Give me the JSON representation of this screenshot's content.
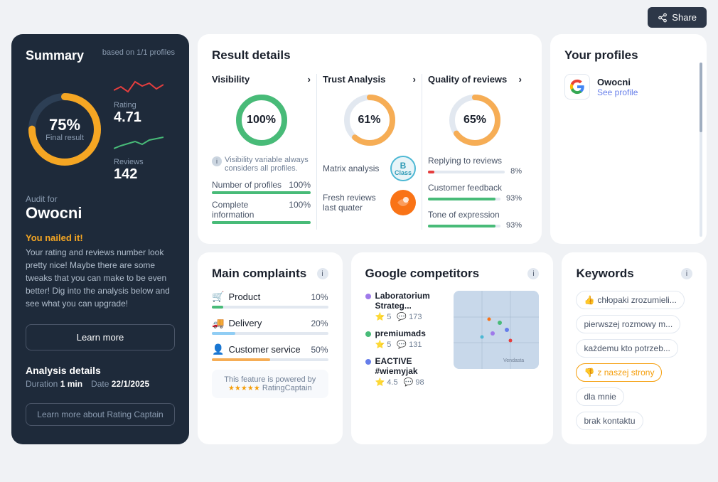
{
  "shareButton": {
    "label": "Share"
  },
  "summary": {
    "title": "Summary",
    "basedOn": "based on 1/1 profiles",
    "finalResultPercent": "75%",
    "finalResultLabel": "Final result",
    "ratingLabel": "Rating",
    "ratingValue": "4.71",
    "reviewsLabel": "Reviews",
    "reviewsValue": "142",
    "auditFor": "Audit for",
    "auditName": "Owocni",
    "nailedIt": "You nailed it!",
    "description": "Your rating and reviews number look pretty nice! Maybe there are some tweaks that you can make to be even better! Dig into the analysis below and see what you can upgrade!",
    "learnMoreLabel": "Learn more",
    "analysisTitle": "Analysis details",
    "duration": "1 min",
    "date": "22/1/2025",
    "learnMoreRating": "Learn more about Rating Captain"
  },
  "resultDetails": {
    "title": "Result details",
    "visibility": {
      "title": "Visibility",
      "percent": "100%",
      "note": "Visibility variable always considers all profiles.",
      "numberOfProfiles": "Number of profiles",
      "numberOfProfilesValue": "100%",
      "completeInfo": "Complete information",
      "completeInfoValue": "100%"
    },
    "trust": {
      "title": "Trust Analysis",
      "percent": "61%",
      "matrixAnalysis": "Matrix analysis",
      "matrixClass": "B",
      "matrixClassSub": "Class",
      "freshReviews": "Fresh reviews last quater"
    },
    "quality": {
      "title": "Quality of reviews",
      "percent": "65%",
      "replyingToReviews": "Replying to reviews",
      "replyingPct": "8%",
      "customerFeedback": "Customer feedback",
      "customerFeedbackPct": "93%",
      "toneOfExpression": "Tone of expression",
      "toneOfExpressionPct": "93%"
    }
  },
  "profiles": {
    "title": "Your profiles",
    "items": [
      {
        "name": "Owocni",
        "seeProfile": "See profile"
      }
    ]
  },
  "complaints": {
    "title": "Main complaints",
    "items": [
      {
        "name": "Product",
        "pct": "10%",
        "fillColor": "#48bb78"
      },
      {
        "name": "Delivery",
        "pct": "20%",
        "fillColor": "#90cdf4"
      },
      {
        "name": "Customer service",
        "pct": "50%",
        "fillColor": "#f6ad55"
      }
    ],
    "poweredBy": "This feature is powered by",
    "poweredByBrand": "★★★★★ RatingCaptain"
  },
  "competitors": {
    "title": "Google competitors",
    "items": [
      {
        "name": "Laboratorium Strateg...",
        "rating": "5",
        "reviews": "173",
        "dotColor": "#9f7aea"
      },
      {
        "name": "premiumads",
        "rating": "5",
        "reviews": "131",
        "dotColor": "#48bb78"
      },
      {
        "name": "EACTIVE #wiemyjak",
        "rating": "4.5",
        "reviews": "98",
        "dotColor": "#667eea"
      }
    ]
  },
  "keywords": {
    "title": "Keywords",
    "items": [
      {
        "text": "chłopaki zrozumieli...",
        "type": "thumbsup"
      },
      {
        "text": "pierwszej rozmowy m...",
        "type": "none"
      },
      {
        "text": "każdemu kto potrzeb...",
        "type": "none"
      },
      {
        "text": "z naszej strony",
        "type": "thumbsdown",
        "special": true
      },
      {
        "text": "dla mnie",
        "type": "none"
      },
      {
        "text": "brak kontaktu",
        "type": "none"
      }
    ]
  }
}
